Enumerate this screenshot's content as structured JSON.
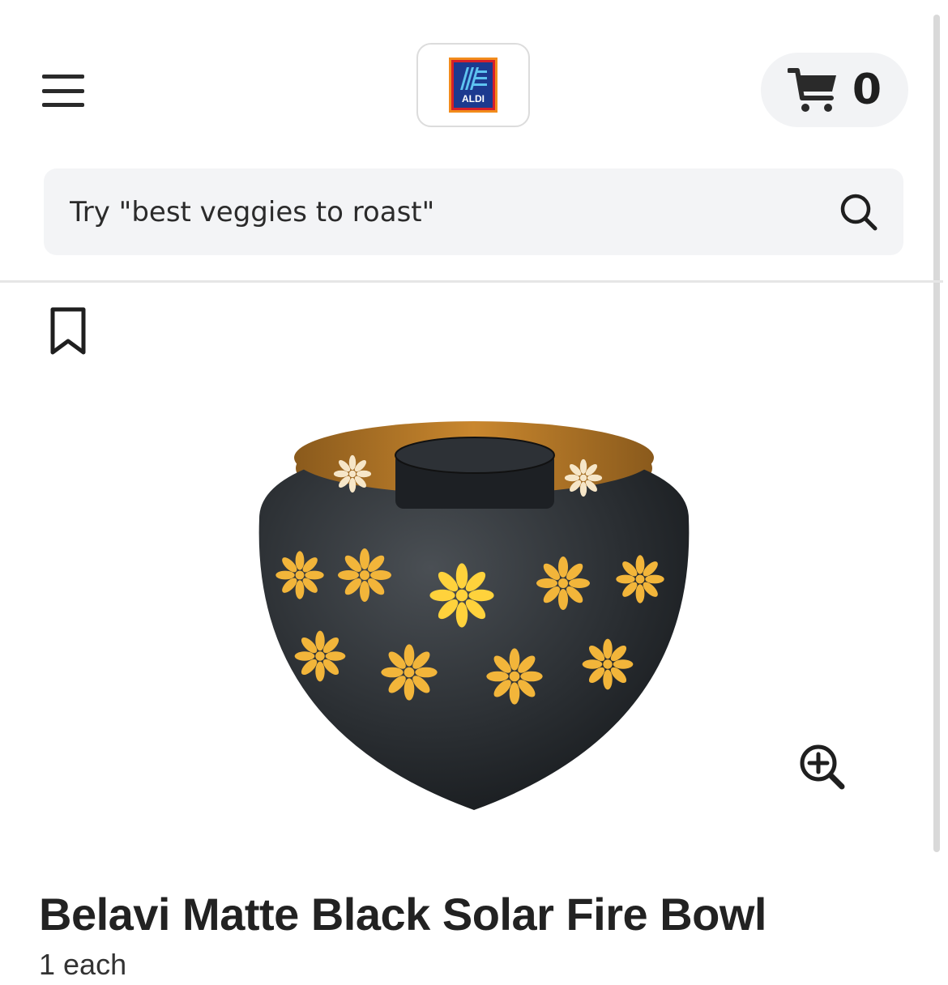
{
  "header": {
    "menu_icon": "hamburger-menu-icon",
    "logo": {
      "text": "ALDI",
      "colors": {
        "blue": "#1c3a8f",
        "orange": "#f28c1c",
        "red": "#d6202a"
      }
    },
    "cart": {
      "icon": "shopping-cart-icon",
      "count": "0"
    }
  },
  "search": {
    "placeholder": "Try \"best veggies to roast\"",
    "icon": "search-icon"
  },
  "product": {
    "bookmark_icon": "bookmark-icon",
    "zoom_icon": "zoom-in-icon",
    "title": "Belavi Matte Black Solar Fire Bowl",
    "size": "1 each"
  }
}
